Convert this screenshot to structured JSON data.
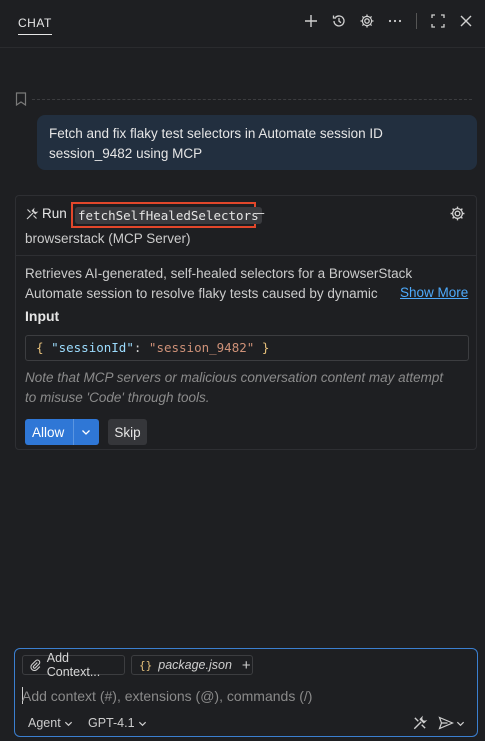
{
  "header": {
    "tab_label": "CHAT",
    "icons": [
      "plus-icon",
      "history-icon",
      "gear-icon",
      "more-icon",
      "maximize-icon",
      "close-icon"
    ]
  },
  "conversation": {
    "user_message_line1": "Fetch and fix flaky test selectors in Automate session ID",
    "user_message_line2": "session_9482 using MCP"
  },
  "tool_call": {
    "run_label": "Run",
    "tool_name": "fetchSelfHealedSelectors",
    "dash": "–",
    "server": "browserstack (MCP Server)",
    "description_line1": "Retrieves AI-generated, self-healed selectors for a BrowserStack",
    "description_line2": "Automate session to resolve flaky tests caused by dynamic",
    "show_more": "Show More",
    "input_label": "Input",
    "input_json": {
      "open": "{",
      "key": "\"sessionId\"",
      "colon": ":",
      "value": "\"session_9482\"",
      "close": "}"
    },
    "note_line1": "Note that MCP servers or malicious conversation content may attempt",
    "note_line2": "to misuse 'Code' through tools.",
    "allow_label": "Allow",
    "skip_label": "Skip"
  },
  "composer": {
    "add_context_label": "Add Context...",
    "file_chip_icon": "{}",
    "file_chip_name": "package.json",
    "input_placeholder": "Add context (#), extensions (@), commands (/)",
    "mode_label": "Agent",
    "model_label": "GPT-4.1"
  },
  "colors": {
    "background": "#1e1f22",
    "accent": "#2f77d6",
    "highlight_box": "#e2472b",
    "link": "#4daafc",
    "user_bubble": "#222f3f"
  }
}
